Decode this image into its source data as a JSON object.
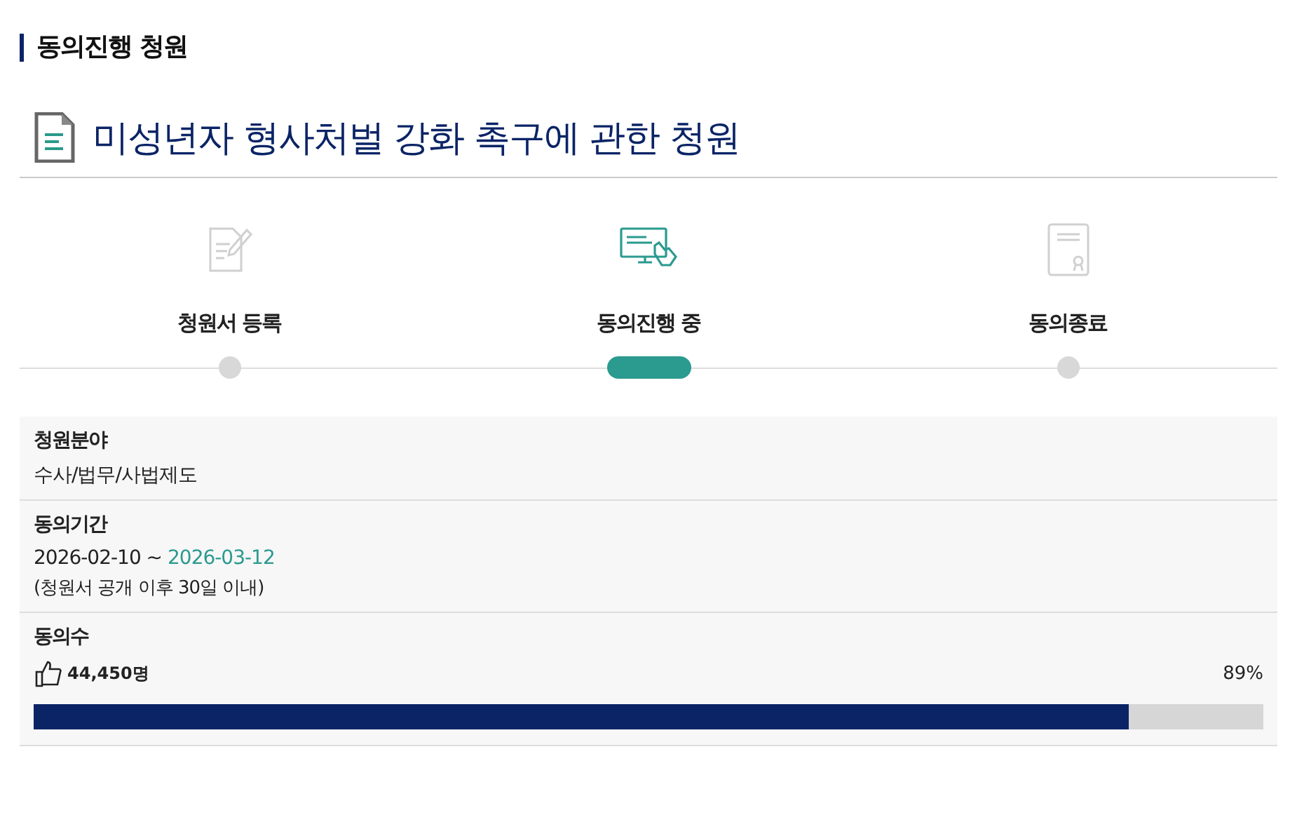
{
  "section_title": "동의진행 청원",
  "petition_title": "미성년자 형사처벌 강화 촉구에 관한 청원",
  "steps": [
    {
      "kind": "register",
      "label": "청원서 등록",
      "selected": false
    },
    {
      "kind": "progress",
      "label": "동의진행 중",
      "selected": true
    },
    {
      "kind": "closed",
      "label": "동의종료",
      "selected": false
    }
  ],
  "info": [
    {
      "kind": "text",
      "label": "청원분야",
      "value": "수사/법무/사법제도"
    },
    {
      "kind": "period",
      "label": "동의기간",
      "start": "2026-02-10 ~",
      "end": "2026-03-12",
      "note": "(청원서 공개 이후 30일 이내)"
    },
    {
      "kind": "count",
      "label": "동의수",
      "value": "44,450명",
      "percent": "89%",
      "level": 0.89
    }
  ]
}
